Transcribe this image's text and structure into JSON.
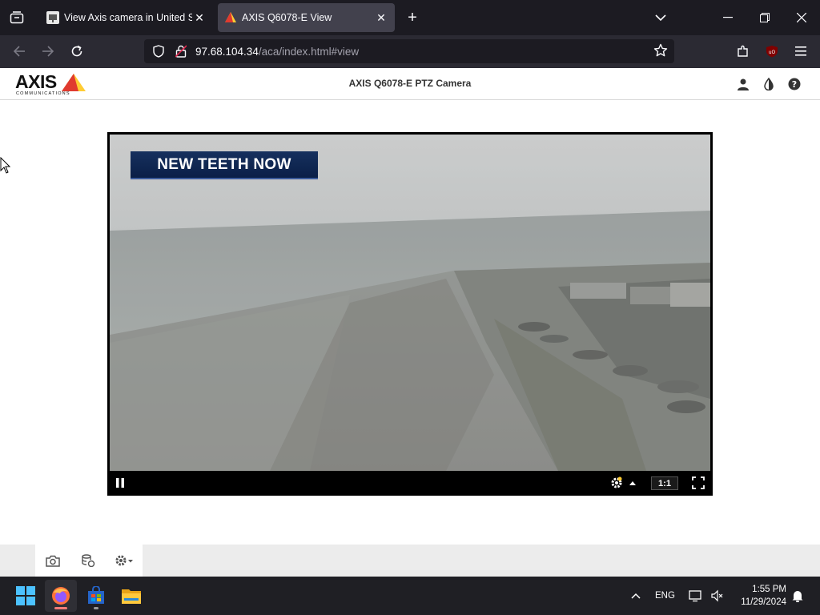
{
  "browser": {
    "tabs": [
      {
        "title": "View Axis camera in United Stat",
        "active": false
      },
      {
        "title": "AXIS Q6078-E View",
        "active": true
      }
    ],
    "url_host": "97.68.104.34",
    "url_path": "/aca/index.html#view"
  },
  "app": {
    "logo_text": "AXIS",
    "logo_subtext": "COMMUNICATIONS",
    "title": "AXIS Q6078-E PTZ Camera",
    "header_icons": [
      "user-icon",
      "contrast-icon",
      "help-icon"
    ]
  },
  "video": {
    "overlay_text": "NEW TEETH NOW",
    "ratio_label": "1:1",
    "controls": [
      "pause-icon",
      "stream-settings-icon",
      "fullscreen-icon"
    ]
  },
  "toolbar": {
    "icons": [
      "camera-snapshot-icon",
      "recordings-icon",
      "settings-icon"
    ]
  },
  "taskbar": {
    "language": "ENG",
    "time": "1:55 PM",
    "date": "11/29/2024"
  },
  "colors": {
    "browser_dark": "#1c1b22",
    "toolbar_dark": "#2b2a33",
    "axis_yellow": "#ffcc33",
    "banner_blue": "#16305e",
    "taskbar": "#1f1f24"
  }
}
